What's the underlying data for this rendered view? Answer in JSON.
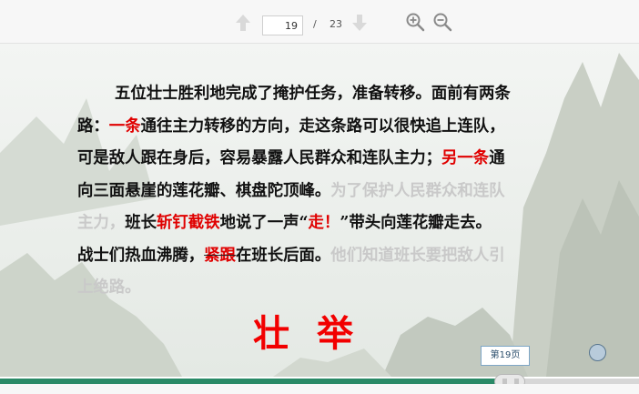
{
  "toolbar": {
    "current_page": "19",
    "separator": "/",
    "total_pages": "23",
    "icons": {
      "prev": "arrow-up-icon",
      "next": "arrow-down-icon",
      "zoom_in": "zoom-in-icon",
      "zoom_out": "zoom-out-icon"
    }
  },
  "slide": {
    "lines": [
      [
        {
          "t": "五位壮士胜利地完成了掩护任务，准备转移。面前有两条",
          "s": "n"
        }
      ],
      [
        {
          "t": "路：",
          "s": "n"
        },
        {
          "t": "一条",
          "s": "r"
        },
        {
          "t": "通往主力转移的方向，走这条路可以很快追上连队，",
          "s": "n"
        }
      ],
      [
        {
          "t": "可是敌人跟在身后，容易暴露人民群众和连队主力；",
          "s": "n"
        },
        {
          "t": "另一条",
          "s": "r"
        },
        {
          "t": "通",
          "s": "n"
        }
      ],
      [
        {
          "t": "向三面悬崖的莲花瓣、棋盘陀顶峰。",
          "s": "n"
        },
        {
          "t": "为了保护人民群众和连队",
          "s": "f"
        }
      ],
      [
        {
          "t": "主力，",
          "s": "f"
        },
        {
          "t": "班长",
          "s": "n"
        },
        {
          "t": "斩钉截铁",
          "s": "r"
        },
        {
          "t": "地说了一声“",
          "s": "n"
        },
        {
          "t": "走！",
          "s": "r"
        },
        {
          "t": "”带头向莲花瓣走去。",
          "s": "n"
        }
      ],
      [
        {
          "t": "战士们热血沸腾，",
          "s": "n"
        },
        {
          "t": "紧跟",
          "s": "k"
        },
        {
          "t": "在班长后面。",
          "s": "n"
        },
        {
          "t": "他们知道班长要把敌人引",
          "s": "f"
        }
      ],
      [
        {
          "t": "上绝路。",
          "s": "f"
        }
      ]
    ],
    "title": "壮举"
  },
  "footer": {
    "page_tip": "第19页",
    "progress_percent": 79.5
  },
  "colors": {
    "text": "#111111",
    "highlight_red": "#e00000",
    "faded": "#c9c9c9",
    "title_red": "#f20000",
    "progress": "#2a8a67"
  }
}
